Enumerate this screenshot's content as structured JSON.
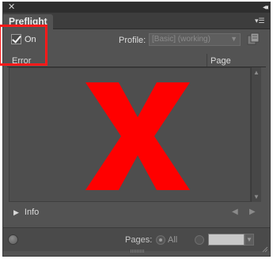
{
  "window": {
    "close_icon": "close-icon",
    "collapse_icon": "collapse-icon"
  },
  "tab": {
    "label": "Preflight"
  },
  "preflight": {
    "on_label": "On",
    "on_checked": true
  },
  "profile": {
    "label": "Profile:",
    "value": "[Basic] (working)"
  },
  "table": {
    "col_error": "Error",
    "col_page": "Page"
  },
  "overlay": {
    "mark": "large red X",
    "color": "#ff0000"
  },
  "info": {
    "label": "Info"
  },
  "pages": {
    "label": "Pages:",
    "all_label": "All",
    "all_selected": true,
    "range_value": ""
  },
  "colors": {
    "panel_bg": "#535353",
    "highlight": "#ff1a1a"
  }
}
